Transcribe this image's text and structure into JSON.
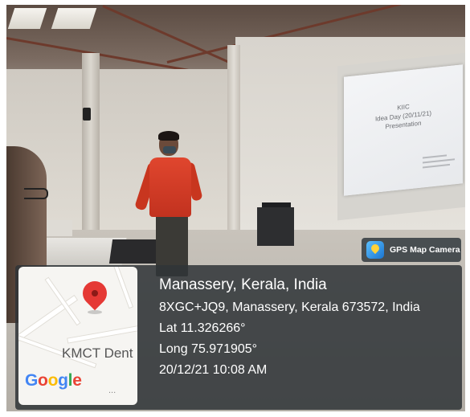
{
  "photo": {
    "scene": "classroom presentation photo",
    "projected_slide": {
      "title": "KIIC",
      "subtitle": "Idea Day (20/11/21)",
      "subtitle2": "Presentation"
    }
  },
  "gps_badge": {
    "icon": "gps-map-camera-logo-icon",
    "label": "GPS Map Camera"
  },
  "map": {
    "icon": "map-pin-icon",
    "place_label": "KMCT Dent",
    "attribution": [
      "G",
      "o",
      "o",
      "g",
      "l",
      "e"
    ],
    "ellipsis": "..."
  },
  "location": {
    "title": "Manassery, Kerala, India",
    "address": "8XGC+JQ9, Manassery, Kerala 673572, India",
    "latitude": "Lat 11.326266°",
    "longitude": "Long 75.971905°",
    "timestamp": "20/12/21 10:08 AM"
  },
  "colors": {
    "overlay": "#303438",
    "pin": "#e53935",
    "shirt": "#d63c26"
  }
}
